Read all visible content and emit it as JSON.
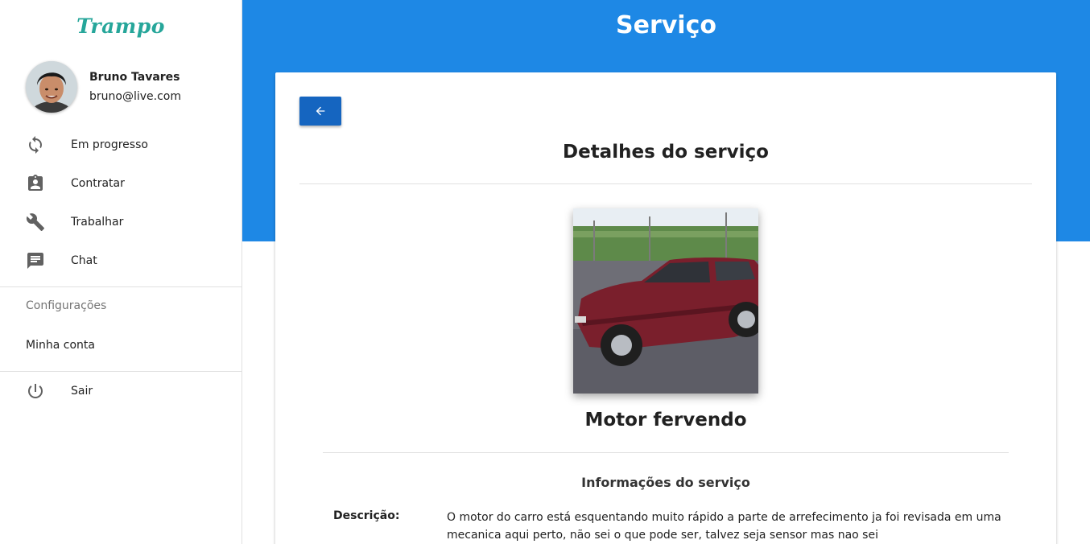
{
  "app": {
    "logo": "Trampo"
  },
  "user": {
    "name": "Bruno Tavares",
    "email": "bruno@live.com"
  },
  "sidebar": {
    "items": [
      {
        "label": "Em progresso",
        "icon": "sync-icon"
      },
      {
        "label": "Contratar",
        "icon": "assignment-ind-icon"
      },
      {
        "label": "Trabalhar",
        "icon": "wrench-icon"
      },
      {
        "label": "Chat",
        "icon": "chat-icon"
      }
    ],
    "settings_header": "Configurações",
    "account_label": "Minha conta",
    "logout": {
      "label": "Sair",
      "icon": "power-icon"
    }
  },
  "header": {
    "title": "Serviço"
  },
  "card": {
    "back_icon": "arrow-left-icon",
    "title": "Detalhes do serviço",
    "service_name": "Motor fervendo",
    "section_title": "Informações do serviço",
    "description_label": "Descrição:",
    "description": "O motor do carro está esquentando muito rápido a parte de arrefecimento ja foi revisada em uma mecanica aqui perto, não sei o que pode ser, talvez seja sensor mas nao sei"
  },
  "colors": {
    "primary": "#1e88e5",
    "button": "#1565c0",
    "logo": "#26a69a"
  }
}
